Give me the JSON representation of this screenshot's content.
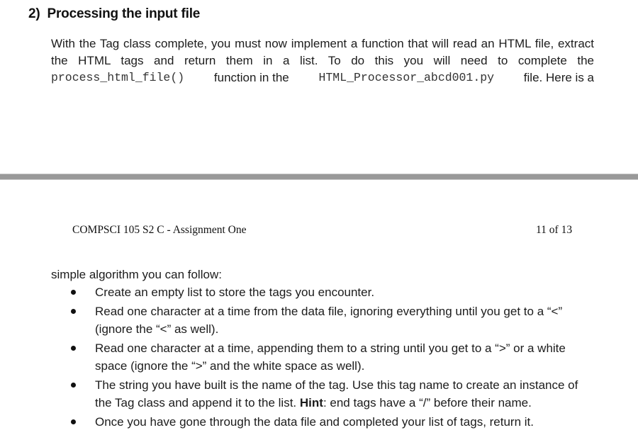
{
  "section": {
    "number": "2)",
    "title": "Processing the input file"
  },
  "paragraph": {
    "line1": "With the Tag class complete, you must now implement a function that will read an HTML file, extract",
    "line2": "the HTML tags and return them in a list. To do this you will need to complete the",
    "line3_code_function": "process_html_file()",
    "line3_text_a": " function in the ",
    "line3_code_file": "HTML_Processor_abcd001.py",
    "line3_text_b": " file. Here is a"
  },
  "page_footer": {
    "course": "COMPSCI 105 S2 C - Assignment One",
    "page_indicator": "11 of 13"
  },
  "continuation": {
    "intro": "simple algorithm you can follow:",
    "bullets": [
      {
        "text": "Create an empty list to store the tags you encounter."
      },
      {
        "text": "Read one character at a time from the data file, ignoring everything until you get to a “<” (ignore the “<” as well)."
      },
      {
        "text": "Read one character at a time, appending them to a string until you get to a “>” or a white space (ignore the “>” and the white space as well)."
      },
      {
        "text_before_hint": "The string you have built is the name of the tag. Use this tag name to create an instance of the Tag class and append it to the list. ",
        "hint_label": "Hint",
        "text_after_hint": ": end tags have a “/” before their name."
      },
      {
        "text": "Once you have gone through the data file and completed your list of tags, return it."
      }
    ]
  }
}
